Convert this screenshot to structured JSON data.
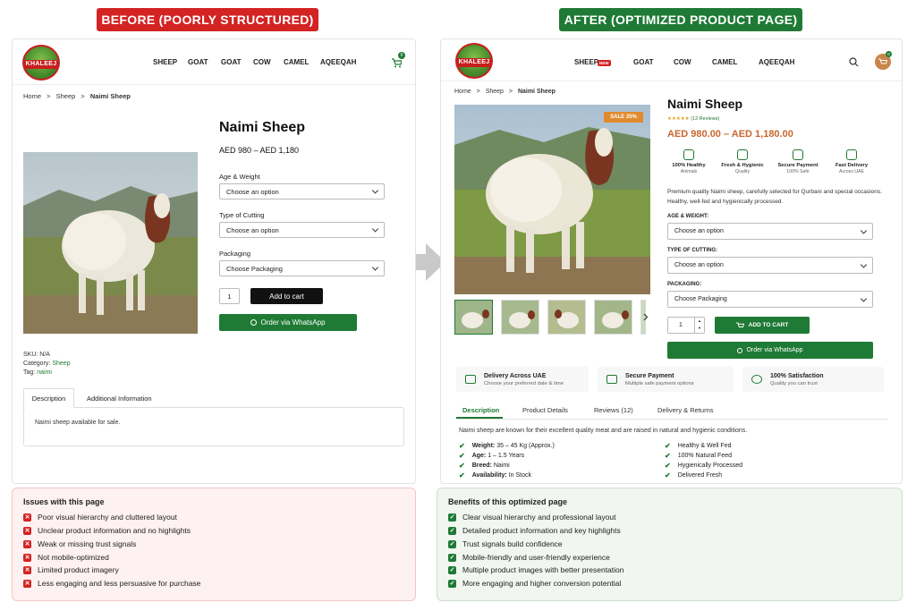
{
  "banners": {
    "before": "BEFORE (POORLY STRUCTURED)",
    "after": "AFTER (OPTIMIZED PRODUCT PAGE)"
  },
  "brand": {
    "logo_text": "KHALEEJ"
  },
  "before": {
    "nav": [
      "SHEEP",
      "GOAT",
      "GOAT",
      "COW",
      "CAMEL",
      "AQEEQAH"
    ],
    "cart_count": "0",
    "breadcrumb": {
      "home": "Home",
      "sep": ">",
      "cat": "Sheep",
      "current": "Naimi Sheep"
    },
    "title": "Naimi Sheep",
    "price": "AED 980 – AED 1,180",
    "fields": [
      {
        "label": "Age & Weight",
        "value": "Choose an option"
      },
      {
        "label": "Type of Cutting",
        "value": "Choose an option"
      },
      {
        "label": "Packaging",
        "value": "Choose Packaging"
      }
    ],
    "qty": "1",
    "add_to_cart": "Add to cart",
    "whatsapp": "Order via WhatsApp",
    "meta": {
      "sku_label": "SKU:",
      "sku": "N/A",
      "cat_label": "Category:",
      "cat": "Sheep",
      "tag_label": "Tag:",
      "tag": "naimi"
    },
    "tabs": [
      "Description",
      "Additional Information"
    ],
    "description": "Naimi sheep available for sale."
  },
  "after": {
    "nav": [
      "SHEEP",
      "GOAT",
      "COW",
      "CAMEL",
      "AQEEQAH"
    ],
    "new_badge": "NEW",
    "cart_count": "0",
    "breadcrumb": {
      "home": "Home",
      "sep": ">",
      "cat": "Sheep",
      "current": "Naimi Sheep"
    },
    "sale_badge": "SALE 25%",
    "title": "Naimi Sheep",
    "stars": "★★★★★",
    "reviews": "(12 Reviews)",
    "price": "AED 980.00 – AED 1,180.00",
    "trust": [
      {
        "title": "100% Healthy",
        "sub": "Animals"
      },
      {
        "title": "Fresh & Hygienic",
        "sub": "Quality"
      },
      {
        "title": "Secure Payment",
        "sub": "100% Safe"
      },
      {
        "title": "Fast Delivery",
        "sub": "Across UAE"
      }
    ],
    "intro": "Premium quality Naimi sheep, carefully selected for Qurbani and special occasions. Healthy, well-fed and hygienically processed.",
    "fields": [
      {
        "label": "AGE & WEIGHT:",
        "value": "Choose an option"
      },
      {
        "label": "TYPE OF CUTTING:",
        "value": "Choose an option"
      },
      {
        "label": "PACKAGING:",
        "value": "Choose Packaging"
      }
    ],
    "qty": "1",
    "add_to_cart": "ADD TO CART",
    "whatsapp": "Order via WhatsApp",
    "features": [
      {
        "title": "Delivery Across UAE",
        "sub": "Choose your preferred date & time"
      },
      {
        "title": "Secure Payment",
        "sub": "Multiple safe payment options"
      },
      {
        "title": "100% Satisfaction",
        "sub": "Quality you can trust"
      }
    ],
    "tabs": [
      "Description",
      "Product Details",
      "Reviews (12)",
      "Delivery & Returns"
    ],
    "description": "Naimi sheep are known for their excellent quality meat and are raised in natural and hygienic conditions.",
    "specs": [
      {
        "k": "Weight:",
        "v": "35 – 45 Kg (Approx.)"
      },
      {
        "k": "Age:",
        "v": "1 – 1.5 Years"
      },
      {
        "k": "Breed:",
        "v": "Naimi"
      },
      {
        "k": "Availability:",
        "v": "In Stock"
      }
    ],
    "highlights": [
      "Healthy & Well Fed",
      "100% Natural Feed",
      "Hygienically Processed",
      "Delivered Fresh"
    ]
  },
  "issues": {
    "title": "Issues with this page",
    "items": [
      "Poor visual hierarchy and cluttered layout",
      "Unclear product information and no highlights",
      "Weak or missing trust signals",
      "Not mobile-optimized",
      "Limited product imagery",
      "Less engaging and less persuasive for purchase"
    ]
  },
  "benefits": {
    "title": "Benefits of this optimized page",
    "items": [
      "Clear visual hierarchy and professional layout",
      "Detailed product information and key highlights",
      "Trust signals build confidence",
      "Mobile-friendly and user-friendly experience",
      "Multiple product images with better presentation",
      "More engaging and higher conversion potential"
    ]
  },
  "colors": {
    "red": "#d32323",
    "green": "#1f7a35",
    "accent_orange": "#c8662e"
  }
}
